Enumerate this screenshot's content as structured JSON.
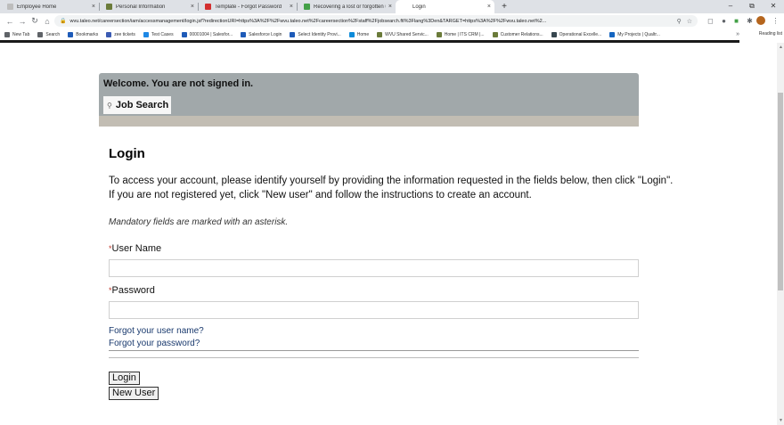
{
  "browser": {
    "tabs": [
      {
        "title": "Employee Home",
        "favicon_color": "#bdbdbd",
        "active": false
      },
      {
        "title": "Personal Information",
        "favicon_color": "#6b7b3a",
        "active": false
      },
      {
        "title": "Template - Forgot Password",
        "favicon_color": "#d32f2f",
        "active": false
      },
      {
        "title": "Recovering a lost or forgotten u...",
        "favicon_color": "#43a047",
        "active": false
      },
      {
        "title": "Login",
        "favicon_color": "#ffffff",
        "active": true
      }
    ],
    "tab_close_glyph": "×",
    "new_tab_glyph": "+",
    "window_controls": [
      "–",
      "⧉",
      "✕"
    ],
    "url": "wvu.taleo.net/careersection/iam/accessmanagement/login.jsf?redirectionURI=https%3A%2F%2Fwvu.taleo.net%2Fcareersection%2Fstaff%2Fjobsearch.ftl%3Flang%3Den&TARGET=https%3A%2F%2Fwvu.taleo.net%2..."
  },
  "bookmarks": [
    {
      "label": "New Tab",
      "color": "#5f6368"
    },
    {
      "label": "Search",
      "color": "#5f6368"
    },
    {
      "label": "Bookmarks",
      "color": "#1e5bb8"
    },
    {
      "label": "zee tickets",
      "color": "#3b5bb3"
    },
    {
      "label": "Test Cases",
      "color": "#1e88e5"
    },
    {
      "label": "00001004 | Salesfor...",
      "color": "#1e5bb8"
    },
    {
      "label": "Salesforce Login",
      "color": "#1e5bb8"
    },
    {
      "label": "Select Identity Provi...",
      "color": "#1e5bb8"
    },
    {
      "label": "Home",
      "color": "#0d8bd9"
    },
    {
      "label": "WVU Shared Servic...",
      "color": "#6b7b3a"
    },
    {
      "label": "Home | ITS CRM |...",
      "color": "#6b7b3a"
    },
    {
      "label": "Customer Relations...",
      "color": "#6b7b3a"
    },
    {
      "label": "Operational Excelle...",
      "color": "#37474f"
    },
    {
      "label": "My Projects | Qualtr...",
      "color": "#1565c0"
    }
  ],
  "bookmarks_more": "»",
  "reading_list": "Reading list",
  "page": {
    "welcome": "Welcome. You are not signed in.",
    "job_search": "Job Search",
    "title": "Login",
    "intro_line1": "To access your account, please identify yourself by providing the information requested in the fields below, then click \"Login\".",
    "intro_line2": "If you are not registered yet, click \"New user\" and follow the instructions to create an account.",
    "mandatory_note": "Mandatory fields are marked with an asterisk.",
    "required_marker": "*",
    "username_label": "User Name",
    "username_value": "",
    "password_label": "Password",
    "password_value": "",
    "forgot_username": "Forgot your user name?",
    "forgot_password": "Forgot your password?",
    "login_button": "Login",
    "new_user_button": "New User"
  }
}
